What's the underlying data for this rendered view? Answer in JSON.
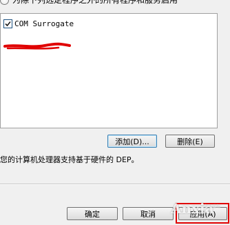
{
  "top": {
    "cut_text": "为除下列选定程序之外的所有程序和服务启用"
  },
  "list": {
    "items": [
      {
        "label": "COM Surrogate",
        "checked": true
      }
    ]
  },
  "buttons": {
    "add": "添加(D)...",
    "delete": "删除(E)",
    "ok": "确定",
    "cancel": "取消",
    "apply": "应用(A)"
  },
  "info": {
    "text": "您的计算机处理器支持基于硬件的 DEP。"
  },
  "annotation": {
    "highlight_color": "#e00000",
    "underline_color": "#e00000"
  },
  "watermark": {
    "text": "Anxia",
    "sub": "安下载站"
  }
}
